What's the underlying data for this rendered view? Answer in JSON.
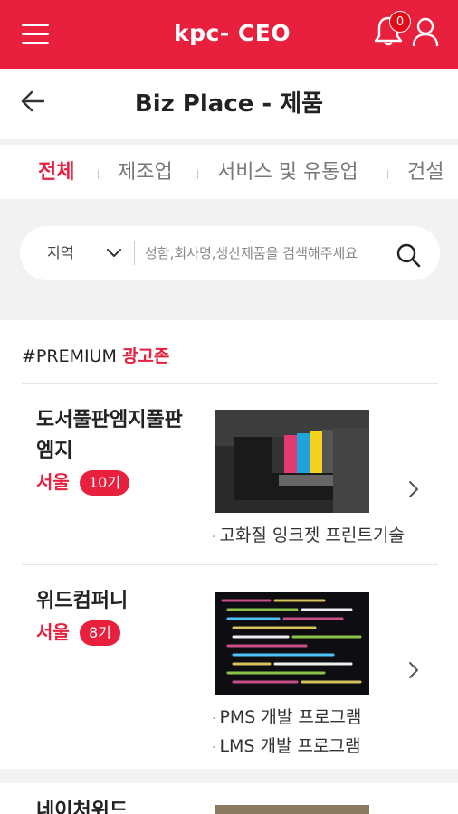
{
  "app": {
    "logo_text": "kpc- CEO",
    "notification_count": "0",
    "brand_color": "#e8203e"
  },
  "header": {
    "title": "Biz Place - 제품",
    "back_icon": "arrow-left-icon",
    "menu_icon": "hamburger-icon",
    "bell_icon": "bell-icon",
    "user_icon": "user-icon"
  },
  "tabs": [
    {
      "label": "전체",
      "active": true
    },
    {
      "label": "제조업",
      "active": false
    },
    {
      "label": "서비스 및 유통업",
      "active": false
    },
    {
      "label": "건설",
      "active": false
    }
  ],
  "search": {
    "region_label": "지역",
    "placeholder": "성함,회사명,생산제품을 검색해주세요",
    "search_icon": "search-icon"
  },
  "premium": {
    "prefix": "#PREMIUM",
    "highlight": "광고존"
  },
  "items": [
    {
      "name": "도서풀판엠지풀판엠지",
      "location": "서울",
      "generation": "10기",
      "tags": [
        "고화질 잉크젯 프린트기술"
      ],
      "image": "ink-cartridges-photo"
    },
    {
      "name": "위드컴퍼니",
      "location": "서울",
      "generation": "8기",
      "tags": [
        "PMS 개발 프로그램",
        "LMS 개발 프로그램"
      ],
      "image": "code-screen-photo"
    },
    {
      "name": "네이처위드",
      "image": "product-photo"
    }
  ]
}
